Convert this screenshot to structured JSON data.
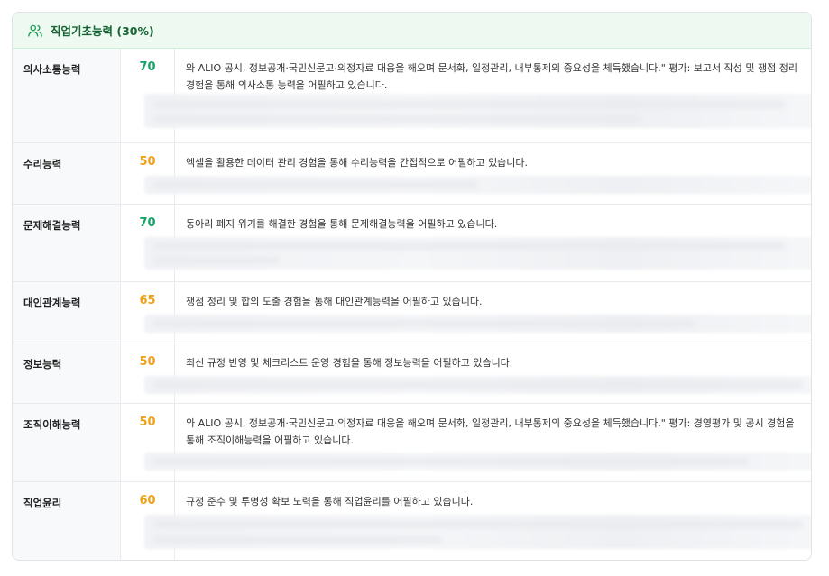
{
  "header": {
    "icon": "users-icon",
    "title": "직업기초능력 (30%)"
  },
  "rows": [
    {
      "name": "의사소통능력",
      "score": "70",
      "level": "high",
      "desc": "와 ALIO 공시, 정보공개·국민신문고·의정자료 대응을 해오며 문서화, 일정관리, 내부통제의 중요성을 체득했습니다.\" 평가: 보고서 작성 및 쟁점 정리 경험을 통해 의사소통 능력을 어필하고 있습니다."
    },
    {
      "name": "수리능력",
      "score": "50",
      "level": "mid",
      "desc": "엑셀을 활용한 데이터 관리 경험을 통해 수리능력을 간접적으로 어필하고 있습니다."
    },
    {
      "name": "문제해결능력",
      "score": "70",
      "level": "high",
      "desc": "동아리 폐지 위기를 해결한 경험을 통해 문제해결능력을 어필하고 있습니다."
    },
    {
      "name": "대인관계능력",
      "score": "65",
      "level": "mid",
      "desc": "쟁점 정리 및 합의 도출 경험을 통해 대인관계능력을 어필하고 있습니다."
    },
    {
      "name": "정보능력",
      "score": "50",
      "level": "mid",
      "desc": "최신 규정 반영 및 체크리스트 운영 경험을 통해 정보능력을 어필하고 있습니다."
    },
    {
      "name": "조직이해능력",
      "score": "50",
      "level": "mid",
      "desc": "와 ALIO 공시, 정보공개·국민신문고·의정자료 대응을 해오며 문서화, 일정관리, 내부통제의 중요성을 체득했습니다.\" 평가: 경영평가 및 공시 경험을 통해 조직이해능력을 어필하고 있습니다."
    },
    {
      "name": "직업윤리",
      "score": "60",
      "level": "mid",
      "desc": "규정 준수 및 투명성 확보 노력을 통해 직업윤리를 어필하고 있습니다."
    }
  ],
  "colors": {
    "score_high": "#16a36a",
    "score_mid": "#f0a21a",
    "header_bg": "#eefaf1",
    "header_text": "#166534"
  }
}
